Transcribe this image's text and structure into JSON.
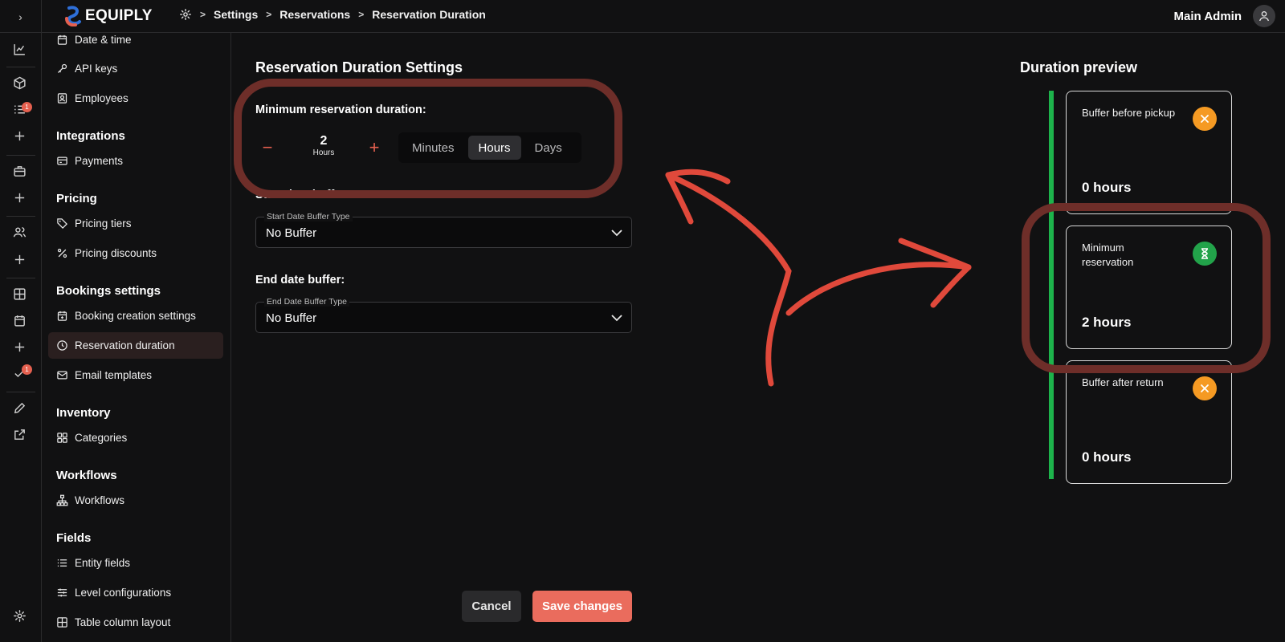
{
  "topbar": {
    "logo_text": "EQUIPLY",
    "breadcrumb": [
      "Settings",
      "Reservations",
      "Reservation Duration"
    ],
    "user_name": "Main Admin"
  },
  "rail": {
    "badges": [
      "1",
      "1"
    ]
  },
  "sidebar": {
    "items_top": [
      {
        "label": "Date & time",
        "icon": "calendar-icon"
      },
      {
        "label": "API keys",
        "icon": "key-icon"
      },
      {
        "label": "Employees",
        "icon": "contact-card-icon"
      }
    ],
    "groups": [
      {
        "title": "Integrations",
        "items": [
          {
            "label": "Payments",
            "icon": "credit-card-icon"
          }
        ]
      },
      {
        "title": "Pricing",
        "items": [
          {
            "label": "Pricing tiers",
            "icon": "tag-icon"
          },
          {
            "label": "Pricing discounts",
            "icon": "percent-icon"
          }
        ]
      },
      {
        "title": "Bookings settings",
        "items": [
          {
            "label": "Booking creation settings",
            "icon": "calendar-plus-icon"
          },
          {
            "label": "Reservation duration",
            "icon": "clock-icon",
            "active": true
          },
          {
            "label": "Email templates",
            "icon": "mail-icon"
          }
        ]
      },
      {
        "title": "Inventory",
        "items": [
          {
            "label": "Categories",
            "icon": "grid-icon"
          }
        ]
      },
      {
        "title": "Workflows",
        "items": [
          {
            "label": "Workflows",
            "icon": "workflow-icon"
          }
        ]
      },
      {
        "title": "Fields",
        "items": [
          {
            "label": "Entity fields",
            "icon": "list-icon"
          },
          {
            "label": "Level configurations",
            "icon": "sliders-icon"
          },
          {
            "label": "Table column layout",
            "icon": "table-icon"
          }
        ]
      }
    ]
  },
  "main": {
    "title": "Reservation Duration Settings",
    "min_label": "Minimum reservation duration:",
    "stepper": {
      "value": "2",
      "unit": "Hours",
      "minus": "−",
      "plus": "+"
    },
    "units": [
      "Minutes",
      "Hours",
      "Days"
    ],
    "selected_unit": "Hours",
    "start_label": "Start date buffer:",
    "start_select": {
      "legend": "Start Date Buffer Type",
      "value": "No Buffer"
    },
    "end_label": "End date buffer:",
    "end_select": {
      "legend": "End Date Buffer Type",
      "value": "No Buffer"
    },
    "cancel": "Cancel",
    "save": "Save changes"
  },
  "preview": {
    "title": "Duration preview",
    "cards": [
      {
        "label": "Buffer before pickup",
        "value": "0 hours",
        "badge": "close-icon",
        "badge_color": "#f59a23"
      },
      {
        "label": "Minimum reservation",
        "value": "2 hours",
        "badge": "hourglass-icon",
        "badge_color": "#22a34a"
      },
      {
        "label": "Buffer after return",
        "value": "0 hours",
        "badge": "close-icon",
        "badge_color": "#f59a23"
      }
    ]
  },
  "colors": {
    "accent": "#ea6c5d",
    "timeline": "#1db34b",
    "highlight": "#6e2e29",
    "arrow": "#e0493b"
  }
}
